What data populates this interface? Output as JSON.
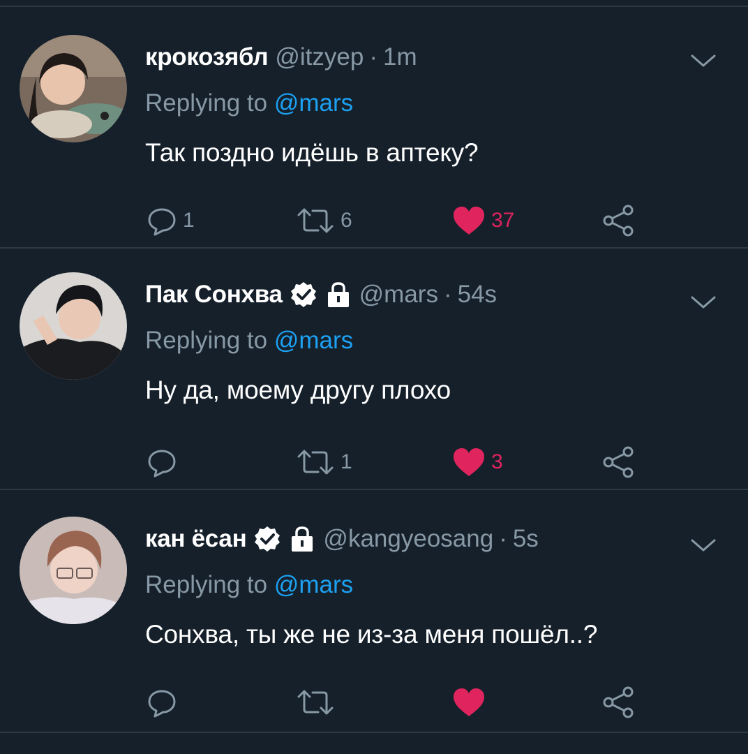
{
  "colors": {
    "background": "#15202b",
    "divider": "#2c3a48",
    "secondary_text": "#8899a6",
    "mention": "#1da1f2",
    "like": "#e0245e"
  },
  "tweets": [
    {
      "display_name": "крокозябл",
      "handle": "@itzyep",
      "time": "1m",
      "verified": false,
      "protected": false,
      "replying_prefix": "Replying to ",
      "replying_to": "@mars",
      "text": "Так поздно идёшь в аптеку?",
      "reply_count": "1",
      "retweet_count": "6",
      "like_count": "37",
      "liked": true,
      "icons": [
        "chevron-down-icon",
        "reply-icon",
        "retweet-icon",
        "heart-icon",
        "share-icon"
      ]
    },
    {
      "display_name": "Пак Сонхва",
      "handle": "@mars",
      "time": "54s",
      "verified": true,
      "protected": true,
      "replying_prefix": "Replying to ",
      "replying_to": "@mars",
      "text": "Ну да, моему другу плохо",
      "reply_count": "",
      "retweet_count": "1",
      "like_count": "3",
      "liked": true,
      "icons": [
        "verified-badge-icon",
        "lock-icon",
        "chevron-down-icon",
        "reply-icon",
        "retweet-icon",
        "heart-icon",
        "share-icon"
      ]
    },
    {
      "display_name": "кан ёсан",
      "handle": "@kangyeosang",
      "time": "5s",
      "verified": true,
      "protected": true,
      "replying_prefix": "Replying to ",
      "replying_to": "@mars",
      "text": "Сонхва, ты же не из-за меня пошёл..?",
      "reply_count": "",
      "retweet_count": "",
      "like_count": "",
      "liked": true,
      "icons": [
        "verified-badge-icon",
        "lock-icon",
        "chevron-down-icon",
        "reply-icon",
        "retweet-icon",
        "heart-icon",
        "share-icon"
      ]
    }
  ]
}
